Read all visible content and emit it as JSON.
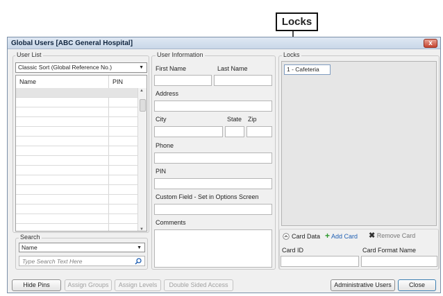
{
  "callout": {
    "label": "Locks"
  },
  "window": {
    "title": "Global Users [ABC General Hospital]",
    "close_glyph": "x"
  },
  "user_list": {
    "group_label": "User List",
    "sort_select": "Classic Sort (Global Reference No.)",
    "columns": [
      "Name",
      "PIN"
    ]
  },
  "search": {
    "group_label": "Search",
    "field_select": "Name",
    "placeholder": "Type Search Text Here"
  },
  "user_info": {
    "group_label": "User Information",
    "first_name": "First Name",
    "last_name": "Last Name",
    "address": "Address",
    "city": "City",
    "state": "State",
    "zip": "Zip",
    "phone": "Phone",
    "pin": "PIN",
    "custom_field": "Custom Field - Set in Options Screen",
    "comments": "Comments"
  },
  "locks": {
    "group_label": "Locks",
    "items": [
      "1 - Cafeteria"
    ]
  },
  "card": {
    "card_data_label": "Card Data",
    "add_card": "Add Card",
    "remove_card": "Remove Card",
    "card_id": "Card ID",
    "card_format": "Card Format Name"
  },
  "buttons": {
    "hide_pins": "Hide Pins",
    "assign_groups": "Assign Groups",
    "assign_levels": "Assign Levels",
    "double_sided": "Double Sided Access",
    "admin_users": "Administrative Users",
    "close": "Close"
  },
  "colors": {
    "accent": "#3c7fb1",
    "title_text": "#10253f",
    "close_red": "#c5432f",
    "add_green": "#2e9a2e"
  }
}
